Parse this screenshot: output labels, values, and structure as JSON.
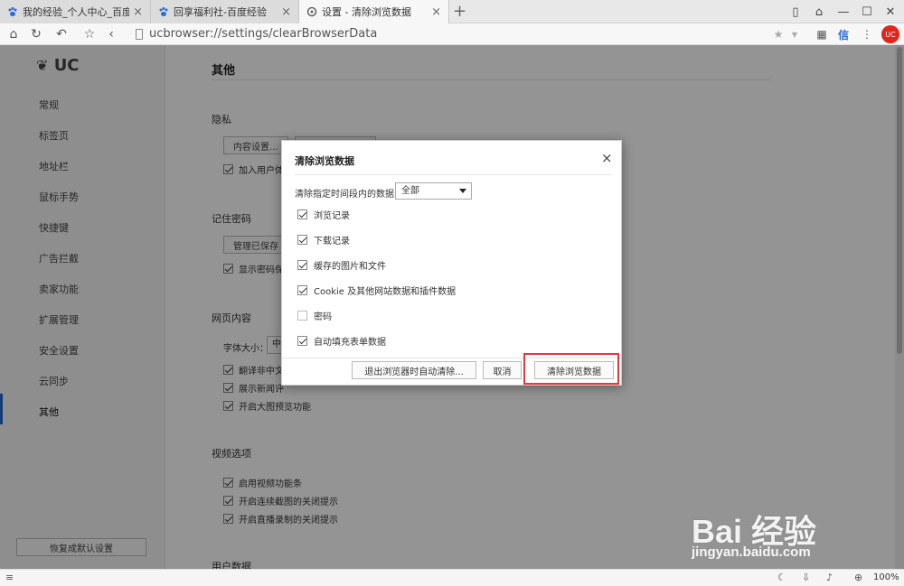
{
  "tabs": [
    {
      "label": "我的经验_个人中心_百度经验"
    },
    {
      "label": "回享福利社-百度经验"
    },
    {
      "label": "设置 - 清除浏览数据"
    }
  ],
  "address": {
    "url": "ucbrowser://settings/clearBrowserData"
  },
  "sidebar": {
    "logo": "UC",
    "items": [
      {
        "label": "常规"
      },
      {
        "label": "标签页"
      },
      {
        "label": "地址栏"
      },
      {
        "label": "鼠标手势"
      },
      {
        "label": "快捷键"
      },
      {
        "label": "广告拦截"
      },
      {
        "label": "卖家功能"
      },
      {
        "label": "扩展管理"
      },
      {
        "label": "安全设置"
      },
      {
        "label": "云同步"
      },
      {
        "label": "其他"
      }
    ],
    "active_index": 10,
    "reset_label": "恢复成默认设置"
  },
  "content": {
    "title": "其他",
    "privacy": {
      "heading": "隐私",
      "content_settings_btn": "内容设置...",
      "join_label": "加入用户体"
    },
    "passwords": {
      "heading": "记住密码",
      "manage_btn": "管理已保存",
      "show_label": "显示密码保"
    },
    "webcontent": {
      "heading": "网页内容",
      "font_label": "字体大小：",
      "font_value": "中",
      "translate_label": "翻译非中文",
      "news_label": "展示新闻评",
      "preview_label": "开启大图预览功能"
    },
    "video": {
      "heading": "视频选项",
      "items": [
        {
          "label": "启用视频功能条"
        },
        {
          "label": "开启连续截图的关闭提示"
        },
        {
          "label": "开启直播录制的关闭提示"
        }
      ]
    },
    "userdata": {
      "heading": "用户数据"
    }
  },
  "dialog": {
    "title": "清除浏览数据",
    "range_label": "清除指定时间段内的数据：",
    "range_value": "全部",
    "options": [
      {
        "label": "浏览记录",
        "checked": true
      },
      {
        "label": "下载记录",
        "checked": true
      },
      {
        "label": "缓存的图片和文件",
        "checked": true
      },
      {
        "label": "Cookie 及其他网站数据和插件数据",
        "checked": true
      },
      {
        "label": "密码",
        "checked": false
      },
      {
        "label": "自动填充表单数据",
        "checked": true
      }
    ],
    "auto_clear_btn": "退出浏览器时自动清除...",
    "cancel_btn": "取消",
    "clear_btn": "清除浏览数据"
  },
  "status": {
    "zoom": "100%"
  },
  "watermark": {
    "line1": "Bai 经验",
    "line2": "jingyan.baidu.com"
  },
  "colors": {
    "accent": "#2266cc",
    "highlight": "#e23b3b"
  }
}
